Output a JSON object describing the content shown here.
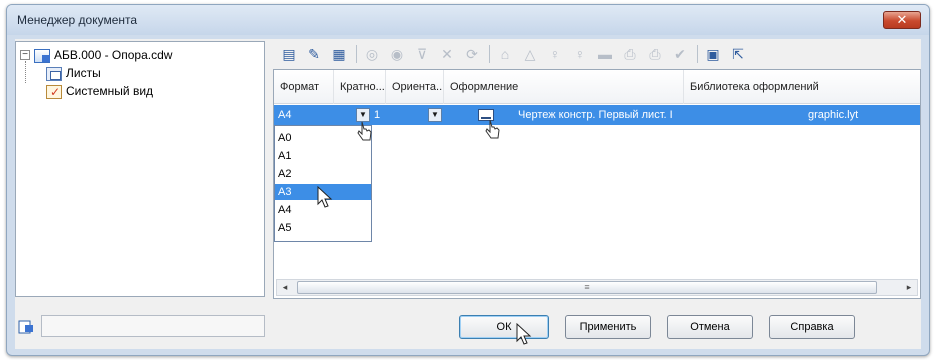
{
  "window": {
    "title": "Менеджер документа",
    "close_glyph": "✕"
  },
  "tree": {
    "root": {
      "label": "АБВ.000 - Опора.cdw",
      "icon": "document-icon",
      "expander": "−"
    },
    "children": [
      {
        "label": "Листы",
        "icon": "sheets-icon"
      },
      {
        "label": "Системный вид",
        "icon": "system-view-icon"
      }
    ]
  },
  "toolbar": {
    "buttons": [
      {
        "name": "new-sheet-icon",
        "glyph": "▤",
        "enabled": true
      },
      {
        "name": "sheet-format-icon",
        "glyph": "✎",
        "enabled": true
      },
      {
        "name": "sheet-properties-icon",
        "glyph": "▦",
        "enabled": true
      },
      {
        "name": "view-create-icon",
        "glyph": "◎",
        "enabled": false
      },
      {
        "name": "view-copy-icon",
        "glyph": "◉",
        "enabled": false
      },
      {
        "name": "filter-icon",
        "glyph": "⊽",
        "enabled": false
      },
      {
        "name": "delete-icon",
        "glyph": "✕",
        "enabled": false
      },
      {
        "name": "layer-icon",
        "glyph": "⟳",
        "enabled": false
      },
      {
        "name": "lock-icon",
        "glyph": "⌂",
        "enabled": false
      },
      {
        "name": "warning-icon",
        "glyph": "△",
        "enabled": false
      },
      {
        "name": "bulb-on-icon",
        "glyph": "♀",
        "enabled": false
      },
      {
        "name": "bulb-off-icon",
        "glyph": "♀",
        "enabled": false
      },
      {
        "name": "color-icon",
        "glyph": "▬",
        "enabled": false
      },
      {
        "name": "print-icon",
        "glyph": "⎙",
        "enabled": false
      },
      {
        "name": "print-all-icon",
        "glyph": "⎙",
        "enabled": false
      },
      {
        "name": "hide-icon",
        "glyph": "✔",
        "enabled": false
      },
      {
        "name": "layers-manager-icon",
        "glyph": "▣",
        "enabled": true
      },
      {
        "name": "export-icon",
        "glyph": "⇱",
        "enabled": true
      }
    ]
  },
  "grid": {
    "columns": [
      "Формат",
      "Кратно...",
      "Ориента...",
      "Оформление",
      "Библиотека оформлений"
    ],
    "row": {
      "format": "А4",
      "multiple": "1",
      "style": "Чертеж констр. Первый лист. I",
      "library": "graphic.lyt",
      "dropdown_arrow": "▼"
    },
    "format_options": [
      "А0",
      "А1",
      "А2",
      "А3",
      "А4",
      "А5"
    ],
    "highlighted_option": "А3",
    "scrollbar": {
      "left": "◂",
      "right": "▸",
      "grip": "≡"
    }
  },
  "status": {
    "text": ""
  },
  "buttons": {
    "ok": "ОК",
    "apply": "Применить",
    "cancel": "Отмена",
    "help": "Справка"
  }
}
